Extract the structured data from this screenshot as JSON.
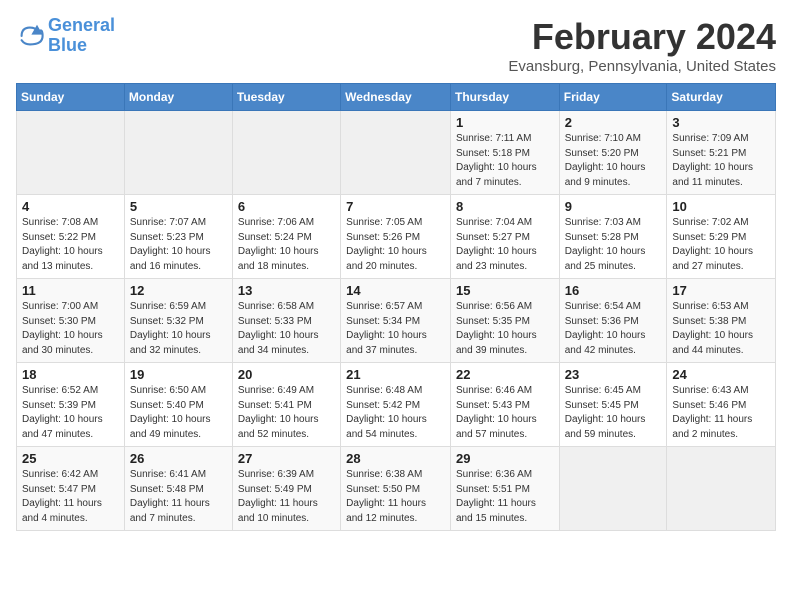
{
  "logo": {
    "line1": "General",
    "line2": "Blue"
  },
  "title": "February 2024",
  "location": "Evansburg, Pennsylvania, United States",
  "days_of_week": [
    "Sunday",
    "Monday",
    "Tuesday",
    "Wednesday",
    "Thursday",
    "Friday",
    "Saturday"
  ],
  "weeks": [
    [
      {
        "day": "",
        "info": ""
      },
      {
        "day": "",
        "info": ""
      },
      {
        "day": "",
        "info": ""
      },
      {
        "day": "",
        "info": ""
      },
      {
        "day": "1",
        "info": "Sunrise: 7:11 AM\nSunset: 5:18 PM\nDaylight: 10 hours\nand 7 minutes."
      },
      {
        "day": "2",
        "info": "Sunrise: 7:10 AM\nSunset: 5:20 PM\nDaylight: 10 hours\nand 9 minutes."
      },
      {
        "day": "3",
        "info": "Sunrise: 7:09 AM\nSunset: 5:21 PM\nDaylight: 10 hours\nand 11 minutes."
      }
    ],
    [
      {
        "day": "4",
        "info": "Sunrise: 7:08 AM\nSunset: 5:22 PM\nDaylight: 10 hours\nand 13 minutes."
      },
      {
        "day": "5",
        "info": "Sunrise: 7:07 AM\nSunset: 5:23 PM\nDaylight: 10 hours\nand 16 minutes."
      },
      {
        "day": "6",
        "info": "Sunrise: 7:06 AM\nSunset: 5:24 PM\nDaylight: 10 hours\nand 18 minutes."
      },
      {
        "day": "7",
        "info": "Sunrise: 7:05 AM\nSunset: 5:26 PM\nDaylight: 10 hours\nand 20 minutes."
      },
      {
        "day": "8",
        "info": "Sunrise: 7:04 AM\nSunset: 5:27 PM\nDaylight: 10 hours\nand 23 minutes."
      },
      {
        "day": "9",
        "info": "Sunrise: 7:03 AM\nSunset: 5:28 PM\nDaylight: 10 hours\nand 25 minutes."
      },
      {
        "day": "10",
        "info": "Sunrise: 7:02 AM\nSunset: 5:29 PM\nDaylight: 10 hours\nand 27 minutes."
      }
    ],
    [
      {
        "day": "11",
        "info": "Sunrise: 7:00 AM\nSunset: 5:30 PM\nDaylight: 10 hours\nand 30 minutes."
      },
      {
        "day": "12",
        "info": "Sunrise: 6:59 AM\nSunset: 5:32 PM\nDaylight: 10 hours\nand 32 minutes."
      },
      {
        "day": "13",
        "info": "Sunrise: 6:58 AM\nSunset: 5:33 PM\nDaylight: 10 hours\nand 34 minutes."
      },
      {
        "day": "14",
        "info": "Sunrise: 6:57 AM\nSunset: 5:34 PM\nDaylight: 10 hours\nand 37 minutes."
      },
      {
        "day": "15",
        "info": "Sunrise: 6:56 AM\nSunset: 5:35 PM\nDaylight: 10 hours\nand 39 minutes."
      },
      {
        "day": "16",
        "info": "Sunrise: 6:54 AM\nSunset: 5:36 PM\nDaylight: 10 hours\nand 42 minutes."
      },
      {
        "day": "17",
        "info": "Sunrise: 6:53 AM\nSunset: 5:38 PM\nDaylight: 10 hours\nand 44 minutes."
      }
    ],
    [
      {
        "day": "18",
        "info": "Sunrise: 6:52 AM\nSunset: 5:39 PM\nDaylight: 10 hours\nand 47 minutes."
      },
      {
        "day": "19",
        "info": "Sunrise: 6:50 AM\nSunset: 5:40 PM\nDaylight: 10 hours\nand 49 minutes."
      },
      {
        "day": "20",
        "info": "Sunrise: 6:49 AM\nSunset: 5:41 PM\nDaylight: 10 hours\nand 52 minutes."
      },
      {
        "day": "21",
        "info": "Sunrise: 6:48 AM\nSunset: 5:42 PM\nDaylight: 10 hours\nand 54 minutes."
      },
      {
        "day": "22",
        "info": "Sunrise: 6:46 AM\nSunset: 5:43 PM\nDaylight: 10 hours\nand 57 minutes."
      },
      {
        "day": "23",
        "info": "Sunrise: 6:45 AM\nSunset: 5:45 PM\nDaylight: 10 hours\nand 59 minutes."
      },
      {
        "day": "24",
        "info": "Sunrise: 6:43 AM\nSunset: 5:46 PM\nDaylight: 11 hours\nand 2 minutes."
      }
    ],
    [
      {
        "day": "25",
        "info": "Sunrise: 6:42 AM\nSunset: 5:47 PM\nDaylight: 11 hours\nand 4 minutes."
      },
      {
        "day": "26",
        "info": "Sunrise: 6:41 AM\nSunset: 5:48 PM\nDaylight: 11 hours\nand 7 minutes."
      },
      {
        "day": "27",
        "info": "Sunrise: 6:39 AM\nSunset: 5:49 PM\nDaylight: 11 hours\nand 10 minutes."
      },
      {
        "day": "28",
        "info": "Sunrise: 6:38 AM\nSunset: 5:50 PM\nDaylight: 11 hours\nand 12 minutes."
      },
      {
        "day": "29",
        "info": "Sunrise: 6:36 AM\nSunset: 5:51 PM\nDaylight: 11 hours\nand 15 minutes."
      },
      {
        "day": "",
        "info": ""
      },
      {
        "day": "",
        "info": ""
      }
    ]
  ]
}
